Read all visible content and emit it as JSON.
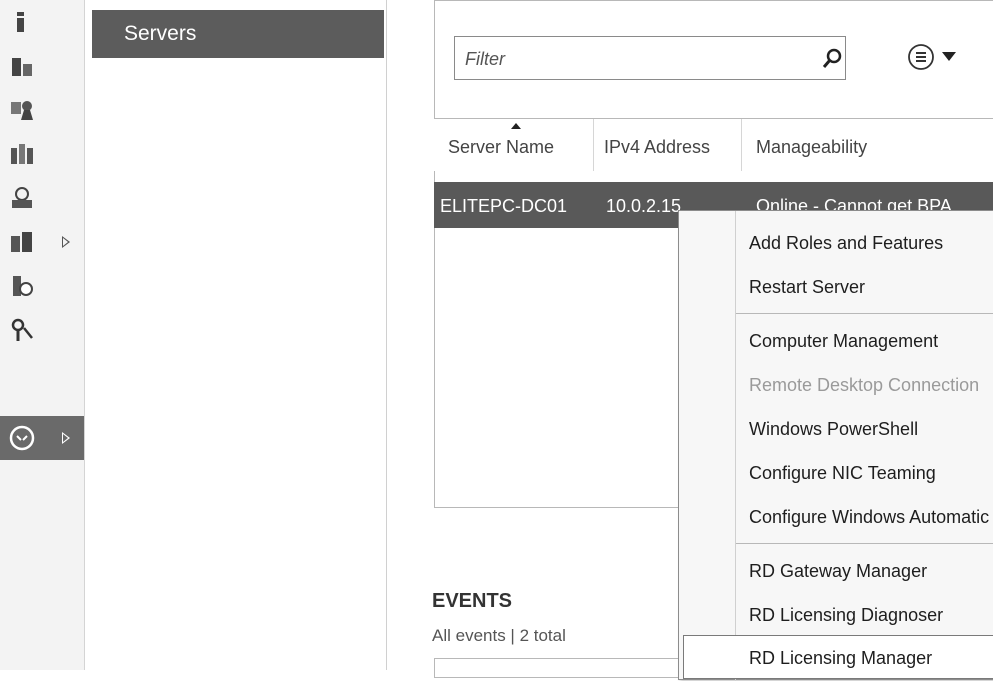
{
  "nav": {
    "items": [
      {
        "label": "Servers"
      }
    ]
  },
  "rail": {
    "items": [
      {
        "icon": "dashboard-icon"
      },
      {
        "icon": "local-server-icon"
      },
      {
        "icon": "all-servers-icon"
      },
      {
        "icon": "ad-ds-icon"
      },
      {
        "icon": "dns-icon"
      },
      {
        "icon": "file-storage-icon",
        "expandable": true
      },
      {
        "icon": "iis-icon"
      },
      {
        "icon": "remote-access-icon"
      },
      {
        "icon": "remote-desktop-services-icon",
        "expandable": true,
        "selected": true
      }
    ]
  },
  "servers": {
    "filter": {
      "placeholder": "Filter",
      "value": ""
    },
    "columns": [
      "Server Name",
      "IPv4 Address",
      "Manageability"
    ],
    "rows": [
      {
        "name": "ELITEPC-DC01",
        "ip": "10.0.2.15",
        "manageability": "Online - Cannot get BPA"
      }
    ]
  },
  "events": {
    "title": "EVENTS",
    "subtitle": "All events | 2 total"
  },
  "context_menu": {
    "items": [
      {
        "label": "Add Roles and Features",
        "enabled": true
      },
      {
        "label": "Restart Server",
        "enabled": true
      },
      {
        "label": "Computer Management",
        "enabled": true
      },
      {
        "label": "Remote Desktop Connection",
        "enabled": false
      },
      {
        "label": "Windows PowerShell",
        "enabled": true
      },
      {
        "label": "Configure NIC Teaming",
        "enabled": true
      },
      {
        "label": "Configure Windows Automatic Feedback",
        "enabled": true
      },
      {
        "label": "RD Gateway Manager",
        "enabled": true
      },
      {
        "label": "RD Licensing Diagnoser",
        "enabled": true
      },
      {
        "label": "RD Licensing Manager",
        "enabled": true,
        "highlighted": true
      }
    ]
  },
  "colors": {
    "selected_row": "#595959",
    "selected_nav": "#5c5c5c",
    "active_rail": "#6a6a6a"
  }
}
